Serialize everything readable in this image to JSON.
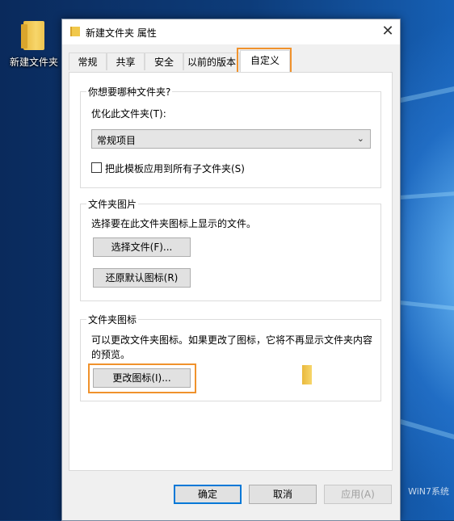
{
  "desktop": {
    "icon_label": "新建文件夹",
    "icon_name": "folder-icon",
    "watermark": "WiN7系统"
  },
  "dialog": {
    "title": "新建文件夹 属性",
    "close": "✕",
    "tabs": [
      "常规",
      "共享",
      "安全",
      "以前的版本",
      "自定义"
    ],
    "active_tab": "自定义",
    "group1": {
      "legend": "你想要哪种文件夹?",
      "optimize_label": "优化此文件夹(T):",
      "optimize_value": "常规项目",
      "apply_checkbox_label": "把此模板应用到所有子文件夹(S)",
      "apply_checked": false
    },
    "group2": {
      "legend": "文件夹图片",
      "description": "选择要在此文件夹图标上显示的文件。",
      "choose_file": "选择文件(F)...",
      "restore_default": "还原默认图标(R)"
    },
    "group3": {
      "legend": "文件夹图标",
      "description_line1": "可以更改文件夹图标。如果更改了图标，它将不再显示文件夹内容",
      "description_line2": "的预览。",
      "change_icon": "更改图标(I)..."
    },
    "footer": {
      "ok": "确定",
      "cancel": "取消",
      "apply": "应用(A)"
    },
    "highlight_color": "#f0922c"
  }
}
